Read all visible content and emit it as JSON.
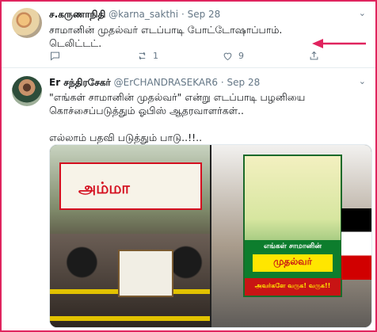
{
  "tweet1": {
    "name": "ச.கருணாநிதி",
    "handle": "@karna_sakthi",
    "separator": "·",
    "time": "Sep 28",
    "text": "சாமானின் முதல்வர் எடப்பாடி போட்டோஷாப்பாம்.\nடெலிட்டட்.",
    "retweets": "1",
    "likes": "9"
  },
  "tweet2": {
    "name": "Er சந்திரசேகர்",
    "handle": "@ErCHANDRASEKAR6",
    "separator": "·",
    "time": "Sep 28",
    "text": "\"எங்கள் சாமானின் முதல்வர்\" என்று எடப்பாடி பழனியை\nகொச்சைப்படுத்தும் ஓபிஸ் ஆதரவாளர்கள்..\n\nஎல்லாம் பதவி படுத்தும் பாடு..!!..",
    "media": {
      "left_banner_text": "அம்மா",
      "right_banner_text": "எங்கள் சாமானின்",
      "right_banner_title": "முதல்வர்",
      "right_banner_sub": "அவர்களே வருக! வருக!!"
    }
  },
  "colors": {
    "frame": "#e0245e",
    "arrow": "#e0245e",
    "muted": "#657786",
    "text": "#14171a"
  },
  "icons": {
    "reply": "reply-icon",
    "retweet": "retweet-icon",
    "like": "heart-icon",
    "share": "share-icon",
    "more": "chevron-down-icon"
  }
}
